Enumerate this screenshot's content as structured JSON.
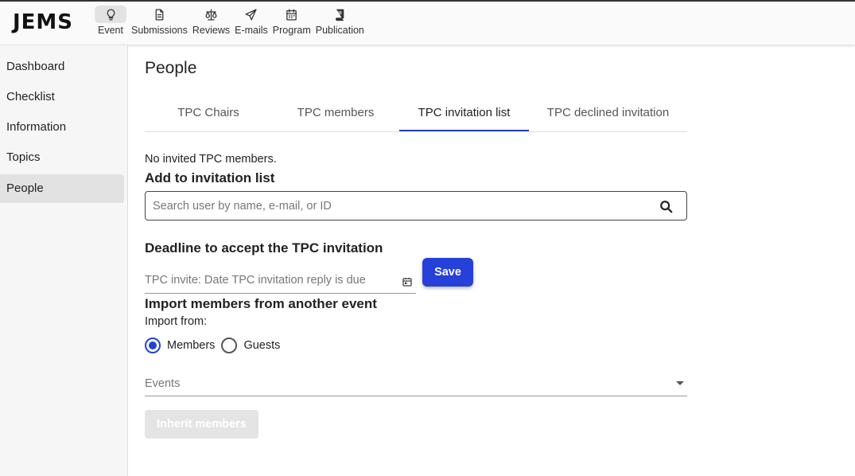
{
  "app": {
    "logo": "JEMS"
  },
  "nav": {
    "items": [
      {
        "label": "Event",
        "icon": "lightbulb-icon",
        "active": true
      },
      {
        "label": "Submissions",
        "icon": "document-icon",
        "active": false
      },
      {
        "label": "Reviews",
        "icon": "scales-icon",
        "active": false
      },
      {
        "label": "E-mails",
        "icon": "paper-plane-icon",
        "active": false
      },
      {
        "label": "Program",
        "icon": "calendar-icon",
        "active": false
      },
      {
        "label": "Publication",
        "icon": "book-icon",
        "active": false
      }
    ]
  },
  "sidebar": {
    "items": [
      {
        "label": "Dashboard",
        "active": false
      },
      {
        "label": "Checklist",
        "active": false
      },
      {
        "label": "Information",
        "active": false
      },
      {
        "label": "Topics",
        "active": false
      },
      {
        "label": "People",
        "active": true
      }
    ]
  },
  "main": {
    "title": "People",
    "tabs": [
      {
        "label": "TPC Chairs",
        "active": false
      },
      {
        "label": "TPC members",
        "active": false
      },
      {
        "label": "TPC invitation list",
        "active": true
      },
      {
        "label": "TPC declined invitation",
        "active": false
      }
    ],
    "empty_message": "No invited TPC members.",
    "add_section": {
      "title": "Add to invitation list",
      "search_placeholder": "Search user by name, e-mail, or ID",
      "search_value": ""
    },
    "deadline_section": {
      "title": "Deadline to accept the TPC invitation",
      "date_placeholder": "TPC invite: Date TPC invitation reply is due",
      "save_label": "Save"
    },
    "import_section": {
      "title": "Import members from another event",
      "import_from_label": "Import from:",
      "options": [
        {
          "label": "Members",
          "checked": true
        },
        {
          "label": "Guests",
          "checked": false
        }
      ],
      "events_label": "Events",
      "inherit_label": "Inherit members",
      "inherit_disabled": true
    }
  },
  "colors": {
    "accent": "#2541d9",
    "tab_indicator": "#2541b2"
  }
}
